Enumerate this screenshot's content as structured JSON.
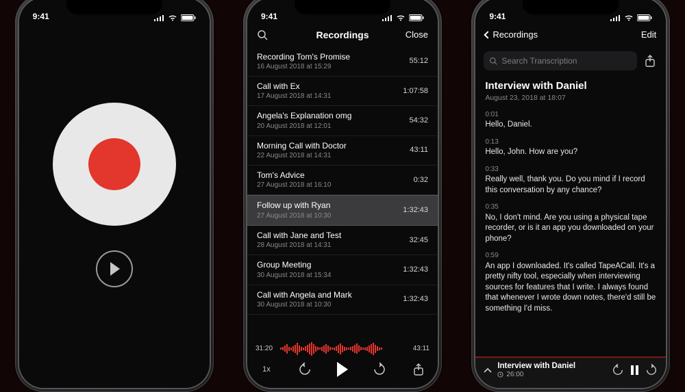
{
  "status": {
    "time": "9:41"
  },
  "record": {},
  "recordings_screen": {
    "title": "Recordings",
    "close_label": "Close"
  },
  "recordings": [
    {
      "title": "Recording Tom's Promise",
      "subtitle": "16 August 2018 at 15:29",
      "duration": "55:12",
      "selected": false
    },
    {
      "title": "Call with Ex",
      "subtitle": "17 August 2018 at 14:31",
      "duration": "1:07:58",
      "selected": false
    },
    {
      "title": "Angela's Explanation omg",
      "subtitle": "20 August 2018 at 12:01",
      "duration": "54:32",
      "selected": false
    },
    {
      "title": "Morning Call with Doctor",
      "subtitle": "22 August 2018 at 14:31",
      "duration": "43:11",
      "selected": false
    },
    {
      "title": "Tom's Advice",
      "subtitle": "27 August 2018 at 16:10",
      "duration": "0:32",
      "selected": false
    },
    {
      "title": "Follow up with Ryan",
      "subtitle": "27 August 2018 at 10:30",
      "duration": "1:32:43",
      "selected": true
    },
    {
      "title": "Call with Jane and Test",
      "subtitle": "28 August 2018 at 14:31",
      "duration": "32:45",
      "selected": false
    },
    {
      "title": "Group Meeting",
      "subtitle": "30 August 2018 at 15:34",
      "duration": "1:32:43",
      "selected": false
    },
    {
      "title": "Call with Angela and Mark",
      "subtitle": "30 August 2018 at 10:30",
      "duration": "1:32:43",
      "selected": false
    }
  ],
  "playbar": {
    "elapsed": "31:20",
    "total": "43:11",
    "speed_label": "1x"
  },
  "transcription_screen": {
    "back_label": "Recordings",
    "edit_label": "Edit",
    "search_placeholder": "Search Transcription"
  },
  "doc": {
    "title": "Interview with Daniel",
    "subtitle": "August 23, 2018 at 18:07"
  },
  "segments": [
    {
      "t": "0:01",
      "text": "Hello, Daniel."
    },
    {
      "t": "0:13",
      "text": "Hello, John. How are you?"
    },
    {
      "t": "0:33",
      "text": "Really well, thank you. Do you mind if I record this conversation by any chance?"
    },
    {
      "t": "0:35",
      "text": "No, I don't mind. Are you using a physical tape recorder, or is it an app you downloaded on your phone?"
    },
    {
      "t": "0:59",
      "text": "An app I downloaded. It's called TapeACall. It's a pretty nifty tool, especially when interviewing sources for features that I write. I always found that whenever I wrote down notes, there'd still be something I'd miss."
    }
  ],
  "miniplayer": {
    "title": "Interview with Daniel",
    "time": "26:00"
  }
}
